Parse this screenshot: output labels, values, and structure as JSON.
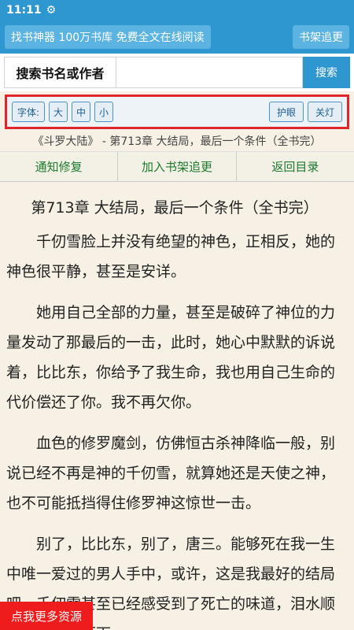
{
  "status_bar": {
    "time": "11:11",
    "icon": "gear-icon"
  },
  "top_bar": {
    "left_button": "找书神器 100万书库 免费全文在线阅读",
    "right_button": "书架追更"
  },
  "search": {
    "label": "搜索书名或作者",
    "value": "",
    "placeholder": "",
    "button": "搜索"
  },
  "toolbar": {
    "font_label": "字体:",
    "large": "大",
    "medium": "中",
    "small": "小",
    "eye_protect": "护眼",
    "lights_off": "关灯",
    "highlight_color": "#e0262b"
  },
  "chapter_info": "《斗罗大陆》 - 第713章 大结局，最后一个条件（全书完）",
  "nav": {
    "report": "通知修复",
    "add_shelf": "加入书架追更",
    "back_catalog": "返回目录"
  },
  "content": {
    "title": "第713章 大结局，最后一个条件（全书完）",
    "paragraphs": [
      "千仞雪脸上并没有绝望的神色，正相反，她的神色很平静，甚至是安详。",
      "她用自己全部的力量，甚至是破碎了神位的力量发动了那最后的一击，此时，她心中默默的诉说着，比比东，你给予了我生命，我也用自己生命的代价偿还了你。我不再欠你。",
      "血色的修罗魔剑，仿佛恒古杀神降临一般，别说已经不再是神的千仞雪，就算她还是天使之神，也不可能抵挡得住修罗神这惊世一击。",
      "别了，比比东，别了，唐三。能够死在我一生中唯一爱过的男人手中，或许，这是我最好的结局吧。千仞雪甚至已经感受到了死亡的味道，泪水顺着眼角流淌而下。"
    ]
  },
  "floating_button": "点我更多资源",
  "colors": {
    "primary": "#2f97cf",
    "background": "#f6f1e4",
    "nav_text": "#1e7a2e",
    "float_button": "#ee1c1c"
  }
}
